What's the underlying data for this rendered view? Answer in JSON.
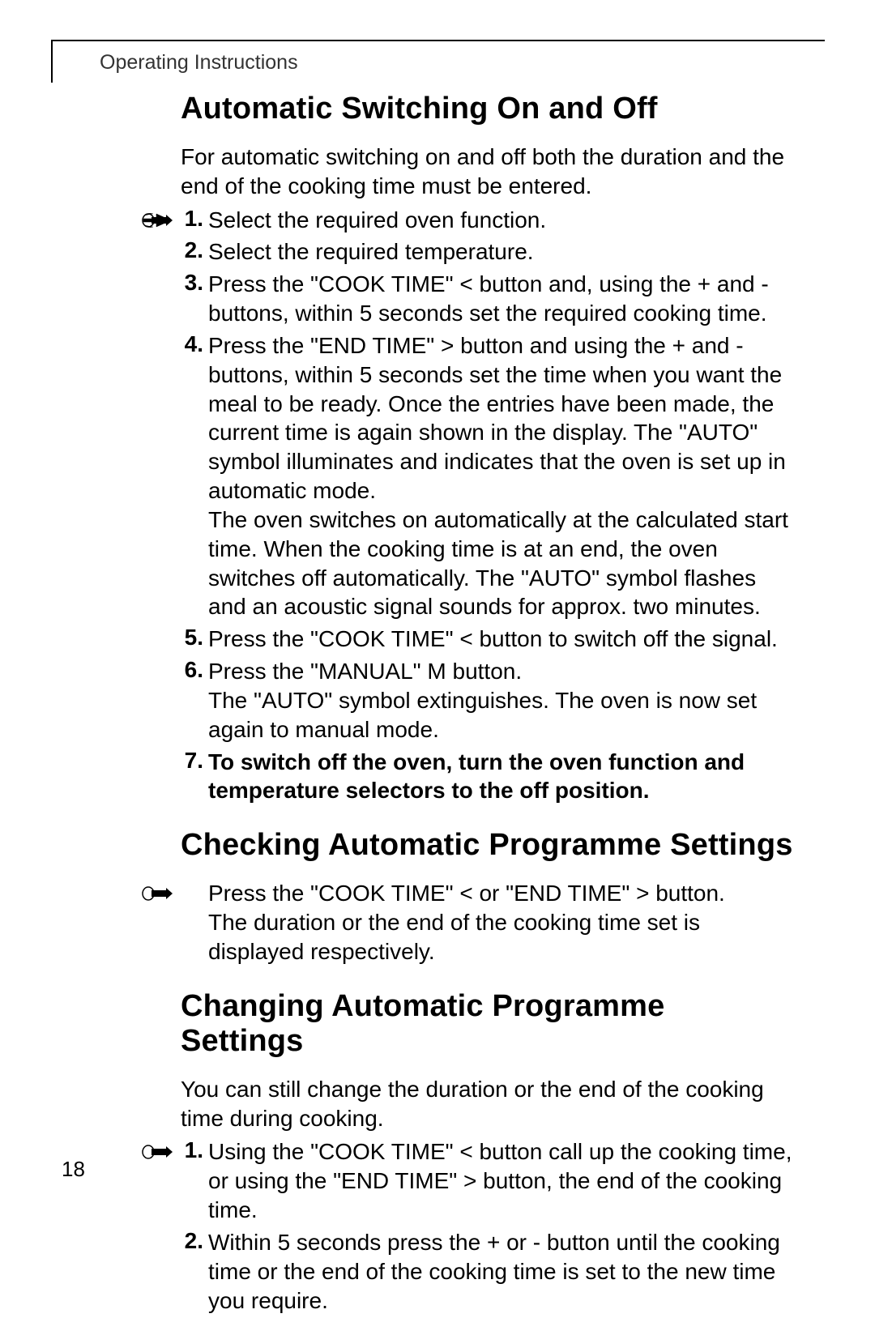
{
  "header": {
    "running": "Operating Instructions"
  },
  "page_number": "18",
  "section1": {
    "title": "Automatic Switching On and Off",
    "intro": "For automatic switching on and off both the duration and the end of the cooking time must be entered.",
    "steps": [
      {
        "num": "1.",
        "text": "Select the required oven function."
      },
      {
        "num": "2.",
        "text": "Select the required temperature."
      },
      {
        "num": "3.",
        "text": "Press the \"COOK TIME\" <   button and, using the +   and -    buttons, within 5 seconds set the required cooking time."
      },
      {
        "num": "4.",
        "text": "Press the \"END TIME\" >   button and using the +   and -    buttons, within 5 seconds set the time when you want the meal to be ready. Once the entries have been made, the current time is again shown in the display. The \"AUTO\" symbol illuminates and indicates that the oven is set up in automatic mode.\nThe oven switches on automatically at the calculated start time. When the cooking time is at an end, the oven switches off automatically. The \"AUTO\" symbol flashes and an acoustic signal sounds for approx. two minutes."
      },
      {
        "num": "5.",
        "text": "Press the \"COOK TIME\" <   button to switch off the signal."
      },
      {
        "num": "6.",
        "text": "Press the \"MANUAL\" M   button.\nThe \"AUTO\" symbol extinguishes. The oven is now set again to manual mode."
      },
      {
        "num": "7.",
        "text_bold": "To switch off the oven, turn the oven function and temperature selectors to the off position."
      }
    ]
  },
  "section2": {
    "title": "Checking Automatic Programme Settings",
    "body": "Press the \"COOK TIME\" <   or \"END TIME\" >   button.\nThe duration or the end of the cooking time set is displayed respectively."
  },
  "section3": {
    "title": "Changing Automatic Programme Settings",
    "intro": "You can still change the duration or the end of the cooking time during cooking.",
    "steps": [
      {
        "num": "1.",
        "text": "Using the \"COOK TIME\" <   button call up the cooking time, or using the \"END TIME\" >   button, the end of the cooking time."
      },
      {
        "num": "2.",
        "text": "Within 5 seconds press the +   or -    button until the cooking time or the end of the cooking time is set to the new time you require."
      }
    ]
  }
}
